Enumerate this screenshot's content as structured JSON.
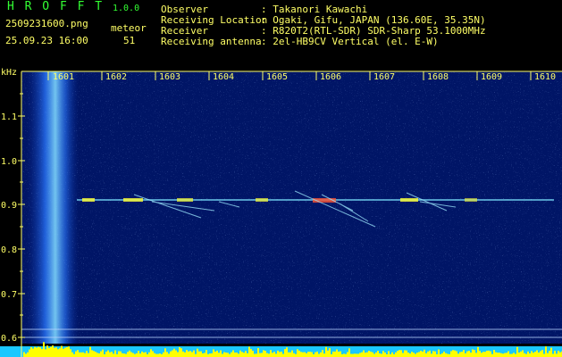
{
  "header": {
    "app_name": "H R O F F T",
    "version": "1.0.0",
    "filename": "2509231600.png",
    "meteor_label": "meteor",
    "timestamp": "25.09.23 16:00",
    "meteor_count": "51",
    "observer_label": "Observer",
    "observer_value": ": Takanori Kawachi",
    "location_label": "Receiving Location",
    "location_value": ": Ogaki, Gifu, JAPAN (136.60E, 35.35N)",
    "receiver_label": "Receiver",
    "receiver_value": ": R820T2(RTL-SDR) SDR-Sharp 53.1000MHz",
    "antenna_label": "Receiving antenna",
    "antenna_value": ": 2el-HB9CV Vertical (el. E-W)"
  },
  "axes": {
    "y_unit": "kHz",
    "x_ticks": [
      "1601",
      "1602",
      "1603",
      "1604",
      "1605",
      "1606",
      "1607",
      "1608",
      "1609",
      "1610"
    ],
    "y_ticks": [
      "1.1",
      "1.0",
      "0.9",
      "0.8",
      "0.7",
      "0.6"
    ]
  },
  "colors": {
    "background": "#000000",
    "header_text": "#ffff66",
    "title_green": "#33ff33",
    "spectrum_bg": "#001566",
    "signal_line": "#7fe8ff",
    "signal_hot": "#ffff33",
    "strip_blue": "#1ac8ff",
    "strip_yellow": "#ffff00"
  }
}
